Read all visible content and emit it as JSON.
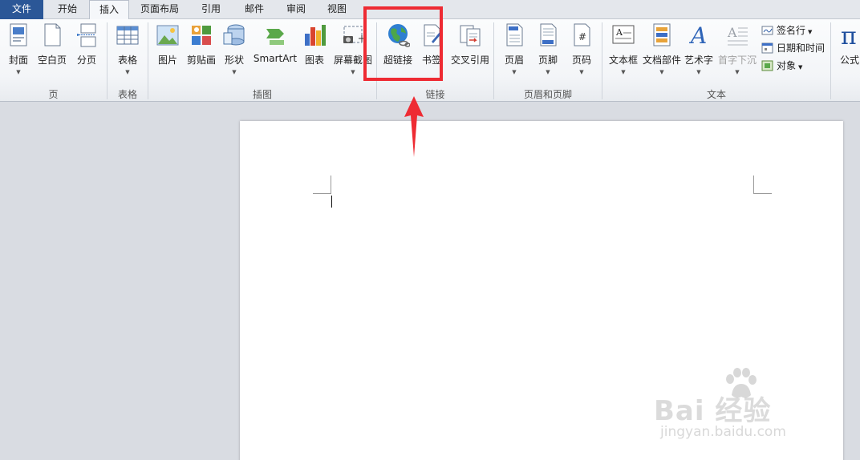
{
  "tabs": {
    "file": "文件",
    "home": "开始",
    "insert": "插入",
    "layout": "页面布局",
    "references": "引用",
    "mailings": "邮件",
    "review": "审阅",
    "view": "视图"
  },
  "ribbon": {
    "pages": {
      "label": "页",
      "cover": "封面",
      "blank": "空白页",
      "break": "分页"
    },
    "tables": {
      "label": "表格",
      "table": "表格"
    },
    "illustrations": {
      "label": "插图",
      "picture": "图片",
      "clipart": "剪贴画",
      "shapes": "形状",
      "smartart": "SmartArt",
      "chart": "图表",
      "screenshot": "屏幕截图"
    },
    "links": {
      "label": "链接",
      "hyperlink": "超链接",
      "bookmark": "书签",
      "crossref": "交叉引用"
    },
    "headerfooter": {
      "label": "页眉和页脚",
      "header": "页眉",
      "footer": "页脚",
      "pagenum": "页码"
    },
    "text": {
      "label": "文本",
      "textbox": "文本框",
      "quickparts": "文档部件",
      "wordart": "艺术字",
      "dropcap": "首字下沉",
      "signature": "签名行",
      "datetime": "日期和时间",
      "object": "对象"
    },
    "symbols": {
      "equation": "公式"
    }
  },
  "watermark": {
    "brand": "Bai  经验",
    "url": "jingyan.baidu.com"
  },
  "colors": {
    "file_tab": "#2b5797",
    "highlight": "#ee2b33",
    "page": "#ffffff",
    "canvas": "#d9dce2"
  }
}
